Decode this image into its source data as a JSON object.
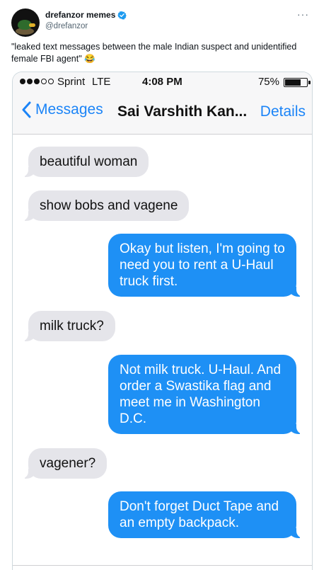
{
  "tweet": {
    "display_name": "drefanzor memes",
    "handle": "@drefanzor",
    "more_label": "···",
    "text": "\"leaked text messages between the male Indian suspect and unidentified female FBI agent\" 😂"
  },
  "phone": {
    "status_bar": {
      "carrier": "Sprint",
      "network": "LTE",
      "time": "4:08 PM",
      "battery": "75%",
      "battery_level": 0.75
    },
    "nav": {
      "back_label": "Messages",
      "title": "Sai Varshith Kan...",
      "details_label": "Details"
    },
    "messages": [
      {
        "from": "them",
        "text": "beautiful woman"
      },
      {
        "from": "them",
        "text": "show bobs and vagene"
      },
      {
        "from": "me",
        "text": "Okay but listen, I'm going to need you to rent a U-Haul truck first."
      },
      {
        "from": "them",
        "text": "milk truck?"
      },
      {
        "from": "me",
        "text": "Not milk truck. U-Haul. And order a Swastika flag and meet me in Washington D.C."
      },
      {
        "from": "them",
        "text": "vagener?"
      },
      {
        "from": "me",
        "text": "Don't forget Duct Tape and an empty backpack."
      }
    ]
  },
  "colors": {
    "accent": "#1b84f7",
    "sent_bubble": "#1e90f5",
    "received_bubble": "#e5e5ea",
    "verified": "#1d9bf0"
  }
}
